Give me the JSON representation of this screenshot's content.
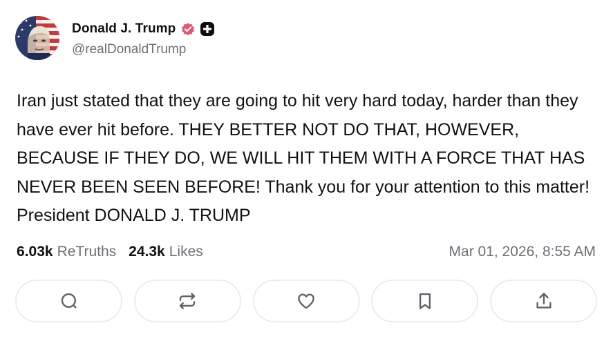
{
  "author": {
    "display_name": "Donald J. Trump",
    "handle": "@realDonaldTrump",
    "verified_icon": "verified-badge-icon",
    "plus_icon": "plus-badge-icon",
    "accent_color": "#e5566f"
  },
  "post": {
    "text": "Iran just stated that they are going to hit very hard today, harder than they have ever hit before. THEY BETTER NOT DO THAT, HOWEVER, BECAUSE IF THEY DO, WE WILL HIT THEM WITH A FORCE THAT HAS NEVER BEEN SEEN BEFORE! Thank you for your attention to this matter! President DONALD J. TRUMP"
  },
  "stats": {
    "retruths_count": "6.03k",
    "retruths_label": "ReTruths",
    "likes_count": "24.3k",
    "likes_label": "Likes",
    "timestamp": "Mar 01, 2026, 8:55 AM"
  },
  "actions": [
    {
      "icon": "reply-icon"
    },
    {
      "icon": "retruth-icon"
    },
    {
      "icon": "like-icon"
    },
    {
      "icon": "bookmark-icon"
    },
    {
      "icon": "share-icon"
    }
  ]
}
